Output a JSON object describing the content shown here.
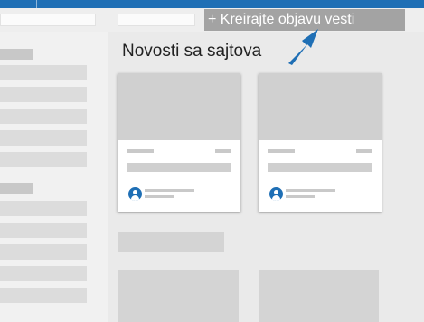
{
  "header": {
    "create_news_label": "+ Kreirajte objavu vesti"
  },
  "main": {
    "section_title": "Novosti sa sajtova"
  },
  "icons": {
    "pointer": "arrow-pointer-icon",
    "author": "person-icon"
  },
  "colors": {
    "accent": "#1f6fb5",
    "create_button": "#a3a3a3"
  }
}
